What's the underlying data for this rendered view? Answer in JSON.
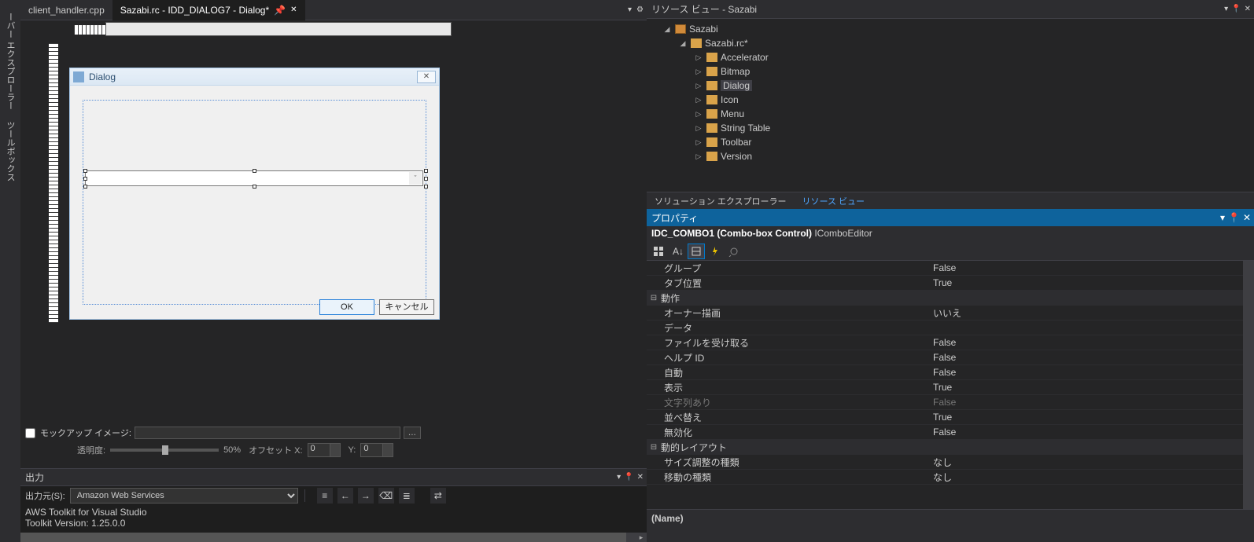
{
  "left_tabs": {
    "explorer": "ーバー エクスプローラー",
    "toolbox": "ツールボックス"
  },
  "tabs": {
    "tab1": "client_handler.cpp",
    "tab2": "Sazabi.rc - IDD_DIALOG7 - Dialog*"
  },
  "dialog": {
    "title": "Dialog",
    "ok": "OK",
    "cancel": "キャンセル"
  },
  "mockup": {
    "label": "モックアップ イメージ:",
    "browse": "...",
    "opacity_label": "透明度:",
    "percent": "50%",
    "offset_x_label": "オフセット X:",
    "x": "0",
    "y_label": "Y:",
    "y": "0"
  },
  "output": {
    "title": "出力",
    "source_label": "出力元(S):",
    "source": "Amazon Web Services",
    "log1": "AWS Toolkit for Visual Studio",
    "log2": "Toolkit Version: 1.25.0.0"
  },
  "resource_view": {
    "title": "リソース ビュー - Sazabi",
    "root": "Sazabi",
    "rc": "Sazabi.rc*",
    "folders": [
      "Accelerator",
      "Bitmap",
      "Dialog",
      "Icon",
      "Menu",
      "String Table",
      "Toolbar",
      "Version"
    ]
  },
  "panel_tabs": {
    "solution": "ソリューション エクスプローラー",
    "resource": "リソース ビュー"
  },
  "properties": {
    "title": "プロパティ",
    "object": "IDC_COMBO1 (Combo-box Control)",
    "objtype": "IComboEditor",
    "rows": [
      {
        "n": "グループ",
        "v": "False"
      },
      {
        "n": "タブ位置",
        "v": "True"
      }
    ],
    "cat1": "動作",
    "rows2": [
      {
        "n": "オーナー描画",
        "v": "いいえ"
      },
      {
        "n": "データ",
        "v": ""
      },
      {
        "n": "ファイルを受け取る",
        "v": "False"
      },
      {
        "n": "ヘルプ ID",
        "v": "False"
      },
      {
        "n": "自動",
        "v": "False"
      },
      {
        "n": "表示",
        "v": "True"
      },
      {
        "n": "文字列あり",
        "v": "False",
        "dis": true
      },
      {
        "n": "並べ替え",
        "v": "True"
      },
      {
        "n": "無効化",
        "v": "False"
      }
    ],
    "cat2": "動的レイアウト",
    "rows3": [
      {
        "n": "サイズ調整の種類",
        "v": "なし"
      },
      {
        "n": "移動の種類",
        "v": "なし"
      }
    ],
    "desc_name": "(Name)"
  }
}
